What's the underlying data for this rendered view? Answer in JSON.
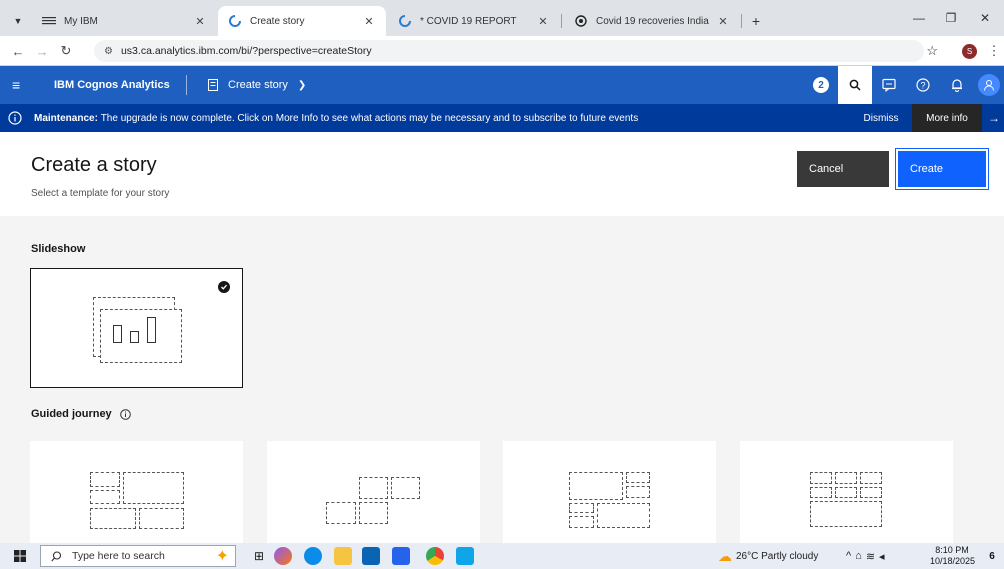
{
  "browser": {
    "tabs": [
      {
        "label": "My IBM",
        "icon": "ibm-logo-icon"
      },
      {
        "label": "Create story",
        "icon": "cognos-icon",
        "active": true
      },
      {
        "label": "* COVID 19 REPORT",
        "icon": "cognos-icon"
      },
      {
        "label": "Covid 19 recoveries India",
        "icon": "openai-icon"
      }
    ],
    "new_tab": "+",
    "url": "us3.ca.analytics.ibm.com/bi/?perspective=createStory",
    "profile_initial": "S"
  },
  "app": {
    "product": "IBM Cognos Analytics",
    "view_name": "Create story",
    "notification_count": "2"
  },
  "banner": {
    "label": "Maintenance:",
    "message": "The upgrade is now complete. Click on More Info to see what actions may be necessary and to subscribe to future events",
    "dismiss": "Dismiss",
    "more_info": "More info"
  },
  "page": {
    "title": "Create a story",
    "subtitle": "Select a template for your story",
    "cancel": "Cancel",
    "create": "Create"
  },
  "sections": {
    "slideshow": "Slideshow",
    "guided": "Guided journey"
  },
  "taskbar": {
    "search_placeholder": "Type here to search",
    "weather": "26°C  Partly cloudy",
    "time": "8:10 PM",
    "date": "10/18/2025",
    "notif_count": "6"
  },
  "colors": {
    "app_header": "#1f5fbf",
    "banner": "#003a9b",
    "primary_button": "#0f62fe",
    "secondary_button": "#393939"
  }
}
